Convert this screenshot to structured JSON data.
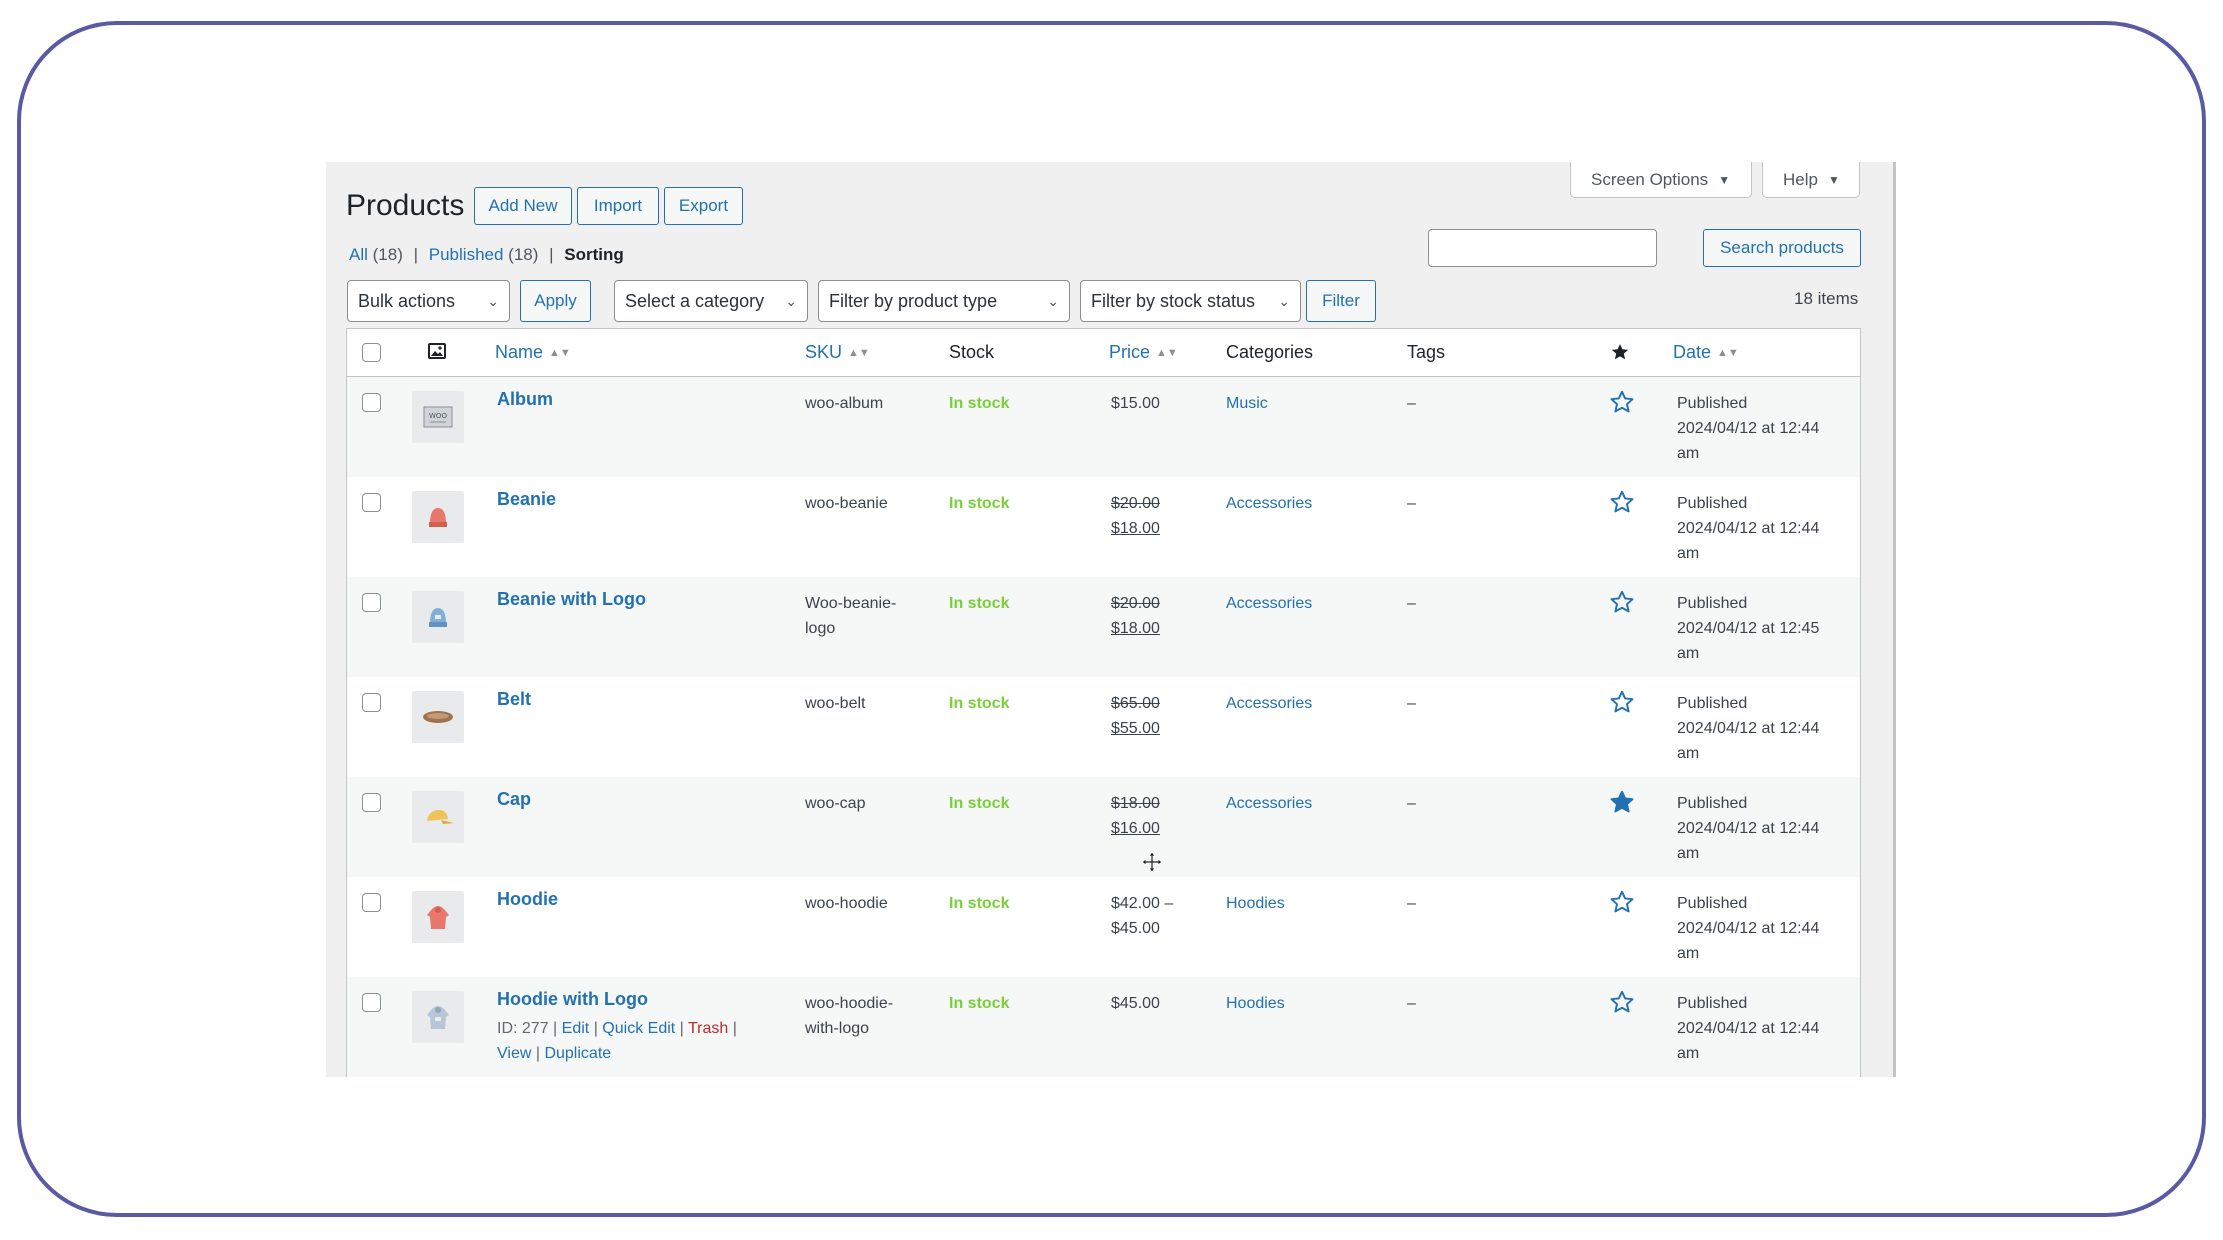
{
  "header": {
    "screen_options": "Screen Options",
    "help": "Help",
    "title": "Products",
    "add_new": "Add New",
    "import": "Import",
    "export": "Export"
  },
  "views": {
    "all": "All",
    "all_count": "(18)",
    "published": "Published",
    "published_count": "(18)",
    "sorting": "Sorting",
    "sep": "|"
  },
  "search": {
    "button": "Search products",
    "value": ""
  },
  "filters": {
    "bulk_actions": "Bulk actions",
    "apply": "Apply",
    "category": "Select a category",
    "product_type": "Filter by product type",
    "stock_status": "Filter by stock status",
    "filter": "Filter",
    "items_count": "18 items"
  },
  "columns": {
    "name": "Name",
    "sku": "SKU",
    "stock": "Stock",
    "price": "Price",
    "categories": "Categories",
    "tags": "Tags",
    "date": "Date"
  },
  "rows": [
    {
      "name": "Album",
      "sku": "woo-album",
      "stock": "In stock",
      "price": "$15.00",
      "category": "Music",
      "tags": "–",
      "featured": false,
      "status": "Published",
      "date": "2024/04/12 at 12:44",
      "ampm": "am"
    },
    {
      "name": "Beanie",
      "sku": "woo-beanie",
      "stock": "In stock",
      "price_old": "$20.00",
      "price_new": "$18.00",
      "category": "Accessories",
      "tags": "–",
      "featured": false,
      "status": "Published",
      "date": "2024/04/12 at 12:44",
      "ampm": "am"
    },
    {
      "name": "Beanie with Logo",
      "sku_line1": "Woo-beanie-",
      "sku_line2": "logo",
      "stock": "In stock",
      "price_old": "$20.00",
      "price_new": "$18.00",
      "category": "Accessories",
      "tags": "–",
      "featured": false,
      "status": "Published",
      "date": "2024/04/12 at 12:45",
      "ampm": "am"
    },
    {
      "name": "Belt",
      "sku": "woo-belt",
      "stock": "In stock",
      "price_old": "$65.00",
      "price_new": "$55.00",
      "category": "Accessories",
      "tags": "–",
      "featured": false,
      "status": "Published",
      "date": "2024/04/12 at 12:44",
      "ampm": "am"
    },
    {
      "name": "Cap",
      "sku": "woo-cap",
      "stock": "In stock",
      "price_old": "$18.00",
      "price_new": "$16.00",
      "category": "Accessories",
      "tags": "–",
      "featured": true,
      "status": "Published",
      "date": "2024/04/12 at 12:44",
      "ampm": "am"
    },
    {
      "name": "Hoodie",
      "sku": "woo-hoodie",
      "stock": "In stock",
      "price_line1": "$42.00 –",
      "price_line2": "$45.00",
      "category": "Hoodies",
      "tags": "–",
      "featured": false,
      "status": "Published",
      "date": "2024/04/12 at 12:44",
      "ampm": "am"
    },
    {
      "name": "Hoodie with Logo",
      "sku_line1": "woo-hoodie-",
      "sku_line2": "with-logo",
      "stock": "In stock",
      "price": "$45.00",
      "category": "Hoodies",
      "tags": "–",
      "featured": false,
      "status": "Published",
      "date": "2024/04/12 at 12:44",
      "ampm": "am",
      "actions": {
        "id": "ID: 277",
        "edit": "Edit",
        "quick_edit": "Quick Edit",
        "trash": "Trash",
        "view": "View",
        "duplicate": "Duplicate",
        "sep": "|"
      }
    }
  ],
  "colors": {
    "accent": "#2271b1",
    "in_stock": "#7ad03a",
    "trash": "#b32d2e",
    "frame": "#5a5aa4"
  },
  "icons": {
    "image_column": "image-icon",
    "featured_column": "star-filled-icon",
    "row_star": "star-outline-icon",
    "cursor": "move-cursor-icon"
  }
}
